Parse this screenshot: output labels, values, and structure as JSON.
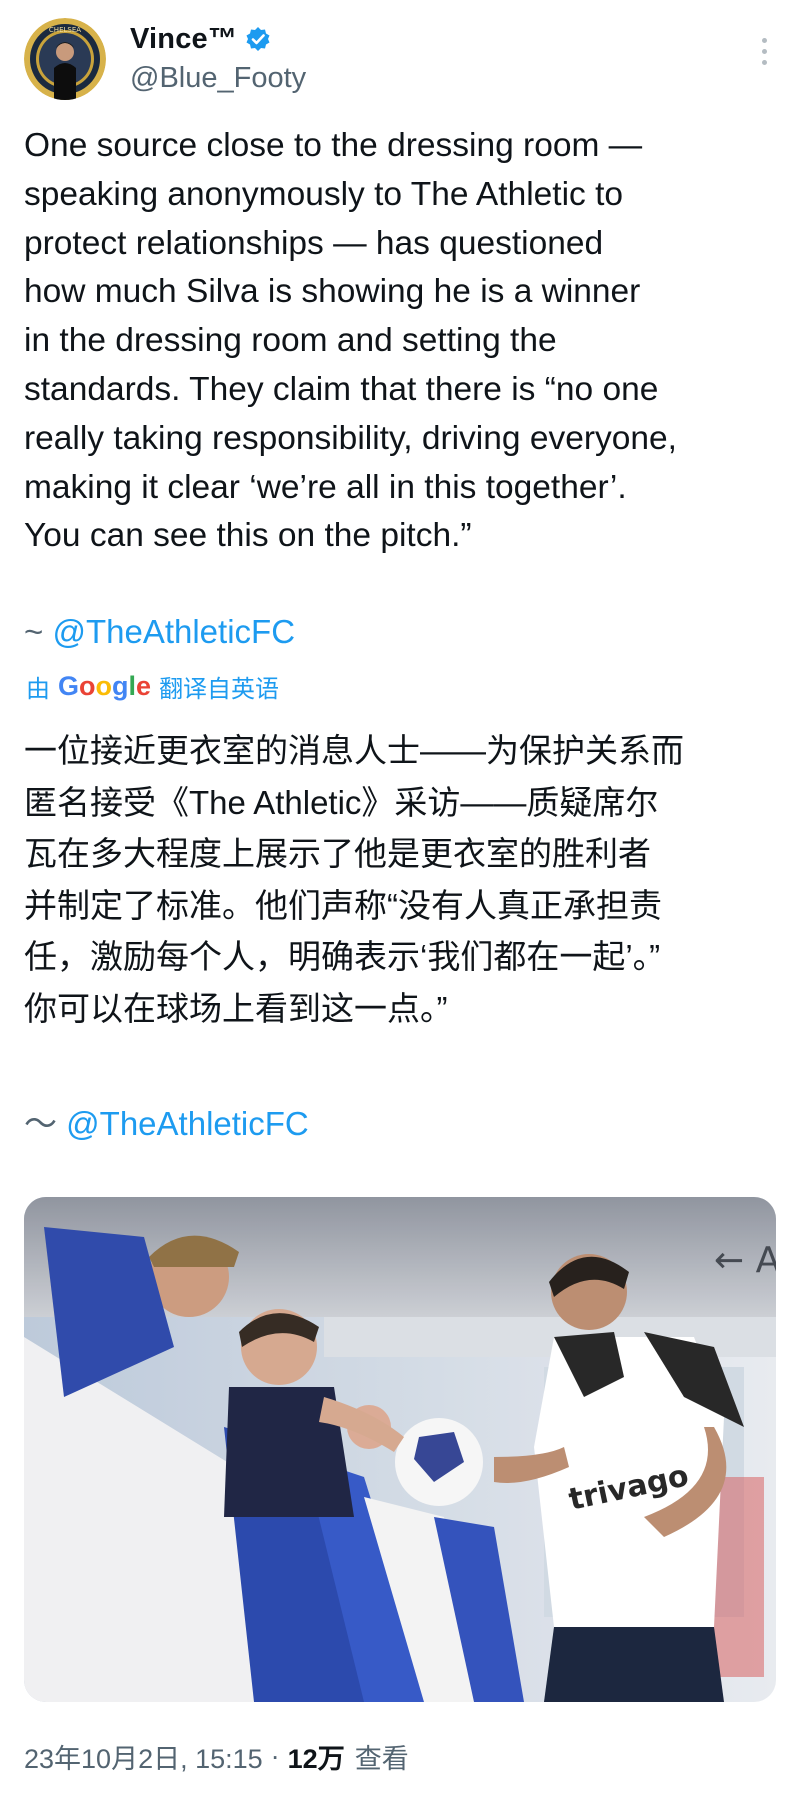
{
  "header": {
    "display_name": "Vince™",
    "handle": "@Blue_Footy",
    "avatar_icon": "chelsea-crest-avatar",
    "verified_icon": "verified-badge-icon",
    "more_icon": "more-options-icon"
  },
  "tweet": {
    "text": "One source close to the dressing room —\nspeaking anonymously to The Athletic to\nprotect relationships — has questioned\nhow much Silva is showing he is a winner\nin the dressing room and setting the\nstandards. They claim that there is “no one\nreally taking responsibility, driving everyone,\nmaking it clear ‘we’re all in this together’.\nYou can see this on the pitch.”",
    "mention_prefix": "~",
    "mention": "@TheAthleticFC"
  },
  "translation": {
    "prefix": "由",
    "brand": "Google",
    "suffix": "翻译自英语",
    "text": "一位接近更衣室的消息人士——为保护关系而\n匿名接受《The Athletic》采访——质疑席尔\n瓦在多大程度上展示了他是更衣室的胜利者\n并制定了标准。他们声称“没有人真正承担责\n任，激励每个人，明确表示‘我们都在一起’。”\n你可以在球场上看到这一点。”",
    "mention_prefix": "〜",
    "mention": "@TheAthleticFC"
  },
  "media": {
    "description_icon": "photo-player-signing-autographs",
    "shirt_text": "trivago"
  },
  "footer": {
    "date": "23年10月2日, 15:15",
    "separator": "·",
    "views_count": "12万",
    "views_label": "查看"
  },
  "colors": {
    "link": "#1d9bf0",
    "text": "#0f1419",
    "secondary": "#536471"
  }
}
